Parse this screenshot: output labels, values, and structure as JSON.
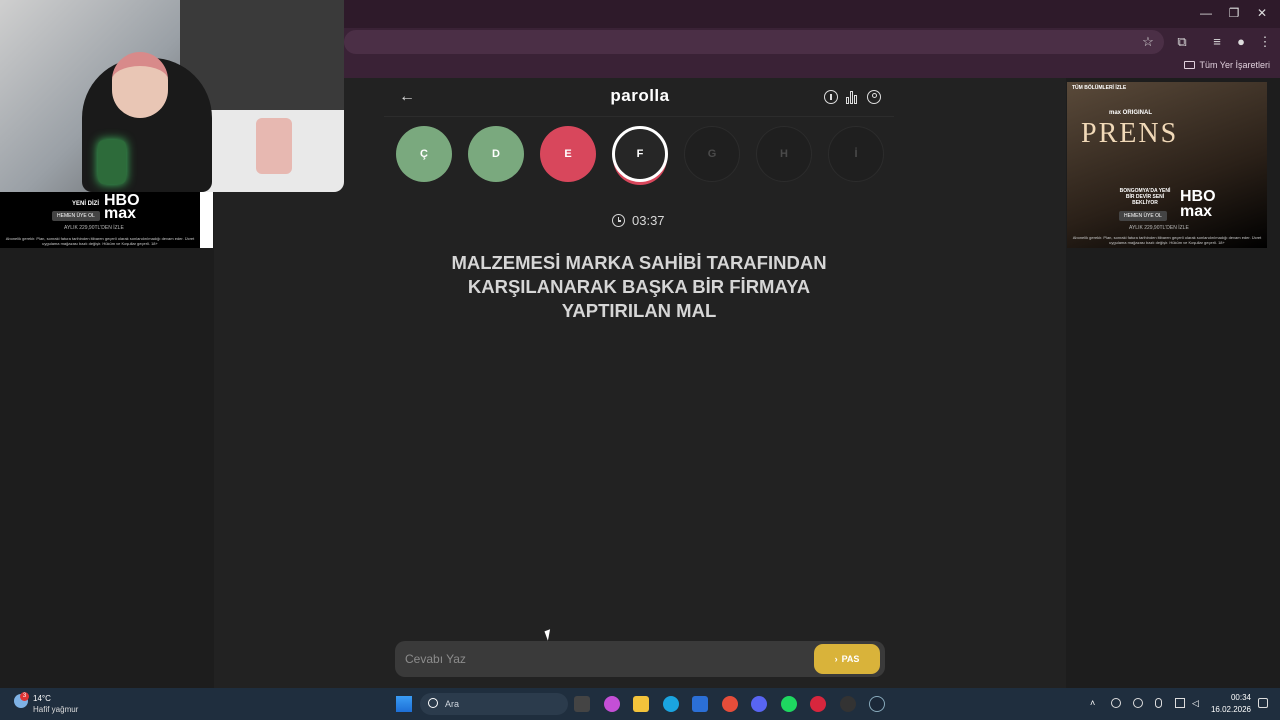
{
  "browser": {
    "bookmarks_all": "Tüm Yer İşaretleri",
    "window_controls": [
      "—",
      "❐",
      "✕"
    ]
  },
  "ads": {
    "left": {
      "tag": "YENİ DİZİ",
      "brand_line1": "HBO",
      "brand_line2": "max",
      "cta": "HEMEN ÜYE OL",
      "price": "AYLIK 229,90TL'DEN İZLE",
      "fine": "Abonelik gerekir. Plan, sonraki fatura tarihinden itibaren geçerli olarak sonlandırılmadığı devam eder. Ücret uygulama mağazası bazlı değişir. Hüküm ve Koşullar geçerli. 18+"
    },
    "right": {
      "top": "TÜM BÖLÜMLERİ İZLE",
      "badge": "max ORIGINAL",
      "title": "PRENS",
      "tagline": "BONGOMYA'DA YENİ BİR DEVİR SENİ BEKLİYOR",
      "brand_line1": "HBO",
      "brand_line2": "max",
      "cta": "HEMEN ÜYE OL",
      "price": "AYLIK 229,90TL'DEN İZLE",
      "fine": "Abonelik gerekir. Plan, sonraki fatura tarihinden itibaren geçerli olarak sonlandırılmadığı devam eder. Ücret uygulama mağazası bazlı değişir. Hüküm ve Koşullar geçerli. 18+"
    }
  },
  "game": {
    "brand": "parolla",
    "letters": [
      {
        "char": "Ç",
        "state": "correct",
        "color": "#7aa97e"
      },
      {
        "char": "D",
        "state": "correct",
        "color": "#7aa97e"
      },
      {
        "char": "E",
        "state": "wrong",
        "color": "#d8475c"
      },
      {
        "char": "F",
        "state": "active",
        "color": "#262626"
      },
      {
        "char": "G",
        "state": "pending",
        "color": "#1f1f1f"
      },
      {
        "char": "H",
        "state": "pending",
        "color": "#1f1f1f"
      },
      {
        "char": "İ",
        "state": "pending",
        "color": "#1f1f1f"
      }
    ],
    "timer": "03:37",
    "question": "MALZEMESİ MARKA SAHİBİ TARAFINDAN KARŞILANARAK BAŞKA BİR FİRMAYA YAPTIRILAN MAL",
    "answer_placeholder": "Cevabı Yaz",
    "pass_label": "PAS",
    "accent": "#d9b33a"
  },
  "taskbar": {
    "weather_badge": "3",
    "temp": "14°C",
    "weather": "Hafif yağmur",
    "search_placeholder": "Ara",
    "time": "00:34",
    "date": "16.02.2026"
  }
}
